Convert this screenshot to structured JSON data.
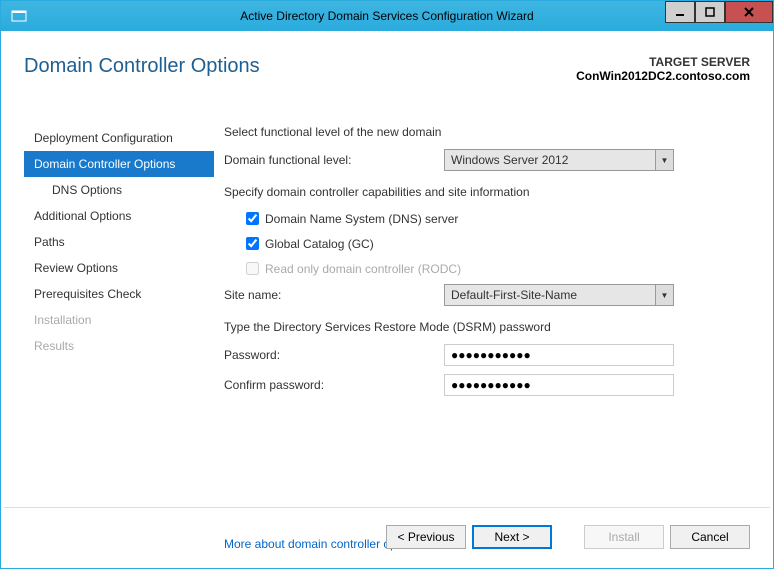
{
  "window": {
    "title": "Active Directory Domain Services Configuration Wizard"
  },
  "header": {
    "page_title": "Domain Controller Options",
    "target_label": "TARGET SERVER",
    "target_name": "ConWin2012DC2.contoso.com"
  },
  "sidebar": {
    "items": [
      {
        "label": "Deployment Configuration",
        "active": false,
        "sub": false,
        "disabled": false
      },
      {
        "label": "Domain Controller Options",
        "active": true,
        "sub": false,
        "disabled": false
      },
      {
        "label": "DNS Options",
        "active": false,
        "sub": true,
        "disabled": false
      },
      {
        "label": "Additional Options",
        "active": false,
        "sub": false,
        "disabled": false
      },
      {
        "label": "Paths",
        "active": false,
        "sub": false,
        "disabled": false
      },
      {
        "label": "Review Options",
        "active": false,
        "sub": false,
        "disabled": false
      },
      {
        "label": "Prerequisites Check",
        "active": false,
        "sub": false,
        "disabled": false
      },
      {
        "label": "Installation",
        "active": false,
        "sub": false,
        "disabled": true
      },
      {
        "label": "Results",
        "active": false,
        "sub": false,
        "disabled": true
      }
    ]
  },
  "main": {
    "section1_head": "Select functional level of the new domain",
    "dfl_label": "Domain functional level:",
    "dfl_value": "Windows Server 2012",
    "section2_head": "Specify domain controller capabilities and site information",
    "dns_label": "Domain Name System (DNS) server",
    "dns_checked": true,
    "gc_label": "Global Catalog (GC)",
    "gc_checked": true,
    "rodc_label": "Read only domain controller (RODC)",
    "rodc_checked": false,
    "site_label": "Site name:",
    "site_value": "Default-First-Site-Name",
    "section3_head": "Type the Directory Services Restore Mode (DSRM) password",
    "pwd_label": "Password:",
    "pwd_value": "●●●●●●●●●●●",
    "confirm_label": "Confirm password:",
    "confirm_value": "●●●●●●●●●●●",
    "more_link": "More about domain controller options"
  },
  "footer": {
    "previous": "< Previous",
    "next": "Next >",
    "install": "Install",
    "cancel": "Cancel"
  }
}
